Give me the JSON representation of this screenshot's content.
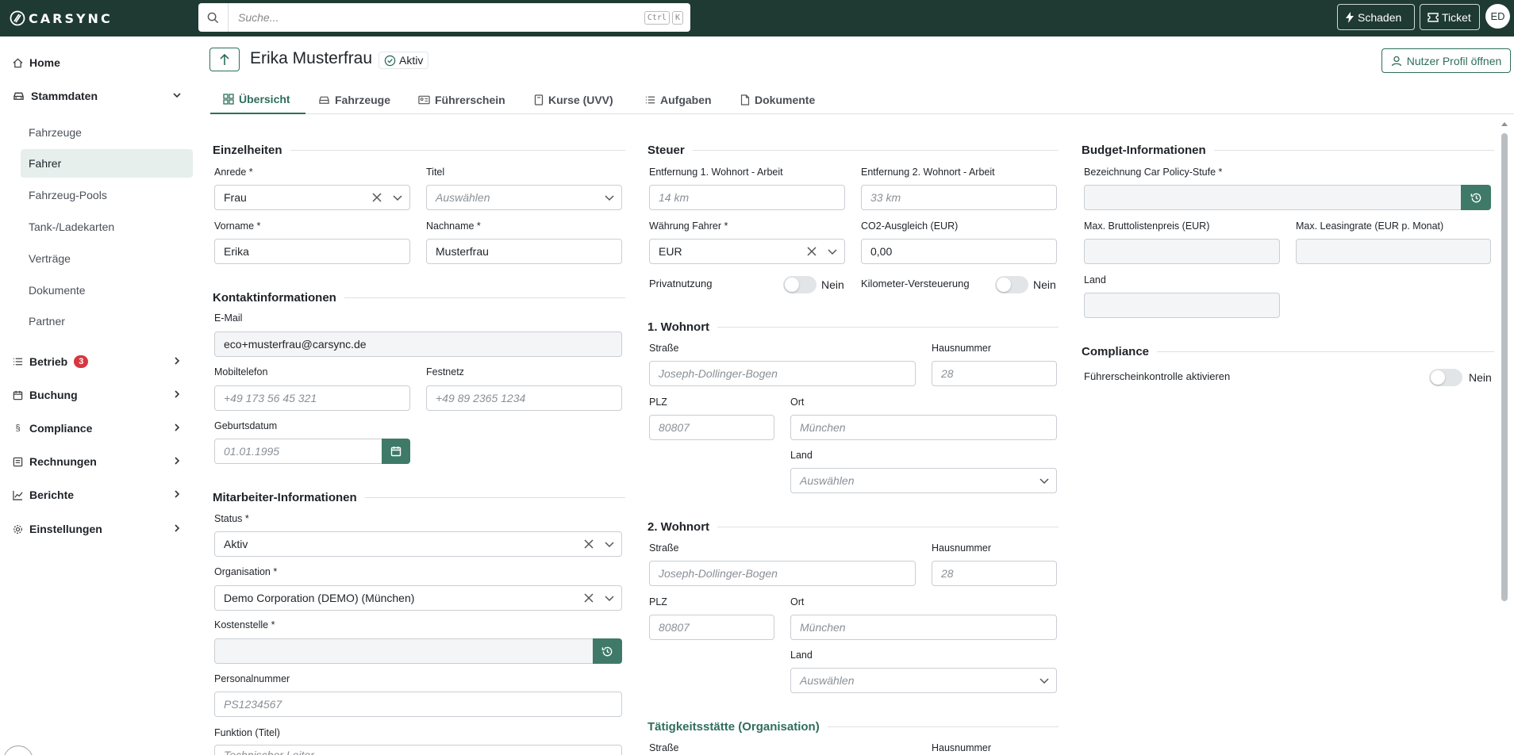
{
  "header": {
    "logo_text": "CARSYNC",
    "search_placeholder": "Suche...",
    "shortcut_keys": [
      "Ctrl",
      "K"
    ],
    "damage_button": "Schaden",
    "ticket_button": "Ticket",
    "avatar_initials": "ED"
  },
  "sidebar": {
    "home": "Home",
    "stammdaten": "Stammdaten",
    "sub_items": [
      "Fahrzeuge",
      "Fahrer",
      "Fahrzeug-Pools",
      "Tank-/Ladekarten",
      "Verträge",
      "Dokumente",
      "Partner"
    ],
    "active_sub": "Fahrer",
    "betrieb": "Betrieb",
    "betrieb_badge": "3",
    "buchung": "Buchung",
    "compliance": "Compliance",
    "rechnungen": "Rechnungen",
    "berichte": "Berichte",
    "einstellungen": "Einstellungen"
  },
  "page": {
    "title": "Erika Musterfrau",
    "status": "Aktiv",
    "profile_button": "Nutzer Profil öffnen",
    "tabs": [
      "Übersicht",
      "Fahrzeuge",
      "Führerschein",
      "Kurse (UVV)",
      "Aufgaben",
      "Dokumente"
    ],
    "active_tab": "Übersicht"
  },
  "einzelheiten": {
    "title": "Einzelheiten",
    "anrede_label": "Anrede *",
    "anrede_value": "Frau",
    "titel_label": "Titel",
    "titel_placeholder": "Auswählen",
    "vorname_label": "Vorname *",
    "vorname_value": "Erika",
    "nachname_label": "Nachname *",
    "nachname_value": "Musterfrau"
  },
  "kontakt": {
    "title": "Kontaktinformationen",
    "email_label": "E-Mail",
    "email_value": "eco+musterfrau@carsync.de",
    "mobil_label": "Mobiltelefon",
    "mobil_placeholder": "+49 173 56 45 321",
    "festnetz_label": "Festnetz",
    "festnetz_placeholder": "+49 89 2365 1234",
    "geburtsdatum_label": "Geburtsdatum",
    "geburtsdatum_placeholder": "01.01.1995"
  },
  "mitarbeiter": {
    "title": "Mitarbeiter-Informationen",
    "status_label": "Status *",
    "status_value": "Aktiv",
    "organisation_label": "Organisation *",
    "organisation_value": "Demo Corporation (DEMO) (München)",
    "kostenstelle_label": "Kostenstelle *",
    "kostenstelle_value": "",
    "personalnummer_label": "Personalnummer",
    "personalnummer_placeholder": "PS1234567",
    "funktion_label": "Funktion (Titel)",
    "funktion_placeholder": "Technischer Leiter"
  },
  "steuer": {
    "title": "Steuer",
    "entf1_label": "Entfernung 1. Wohnort - Arbeit",
    "entf1_placeholder": "14 km",
    "entf2_label": "Entfernung 2. Wohnort - Arbeit",
    "entf2_placeholder": "33 km",
    "waehrung_label": "Währung Fahrer *",
    "waehrung_value": "EUR",
    "co2_label": "CO2-Ausgleich (EUR)",
    "co2_value": "0,00",
    "privatnutzung_label": "Privatnutzung",
    "privatnutzung_value": "Nein",
    "km_label": "Kilometer-Versteuerung",
    "km_value": "Nein"
  },
  "wohnort1": {
    "title": "1. Wohnort",
    "strasse_label": "Straße",
    "strasse_placeholder": "Joseph-Dollinger-Bogen",
    "hausnummer_label": "Hausnummer",
    "hausnummer_placeholder": "28",
    "plz_label": "PLZ",
    "plz_placeholder": "80807",
    "ort_label": "Ort",
    "ort_placeholder": "München",
    "land_label": "Land",
    "land_placeholder": "Auswählen"
  },
  "wohnort2": {
    "title": "2. Wohnort",
    "strasse_label": "Straße",
    "strasse_placeholder": "Joseph-Dollinger-Bogen",
    "hausnummer_label": "Hausnummer",
    "hausnummer_placeholder": "28",
    "plz_label": "PLZ",
    "plz_placeholder": "80807",
    "ort_label": "Ort",
    "ort_placeholder": "München",
    "land_label": "Land",
    "land_placeholder": "Auswählen"
  },
  "taetigkeit": {
    "title": "Tätigkeitsstätte (Organisation)",
    "strasse_label": "Straße",
    "hausnummer_label": "Hausnummer"
  },
  "budget": {
    "title": "Budget-Informationen",
    "policy_label": "Bezeichnung Car Policy-Stufe *",
    "bruttolisten_label": "Max. Bruttolistenpreis (EUR)",
    "leasingrate_label": "Max. Leasingrate (EUR p. Monat)",
    "land_label": "Land"
  },
  "compliance_section": {
    "title": "Compliance",
    "fs_label": "Führerscheinkontrolle aktivieren",
    "fs_value": "Nein"
  },
  "colors": {
    "brand_dark": "#1e3a32",
    "accent_green": "#2e6e5c",
    "badge_red": "#d9363e"
  }
}
